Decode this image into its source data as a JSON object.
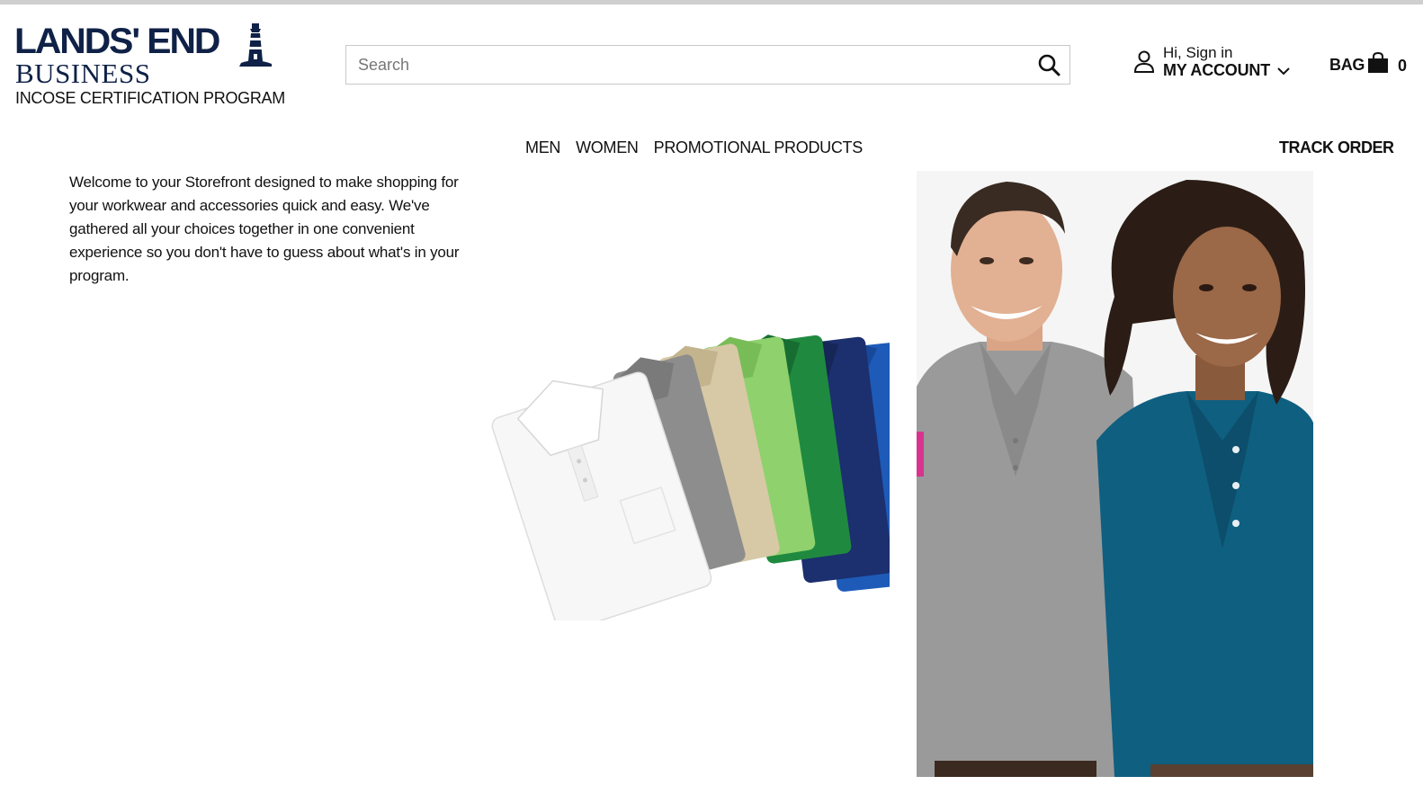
{
  "brand": {
    "logo_main": "LANDS' END",
    "logo_sub": "BUSINESS",
    "program": "INCOSE CERTIFICATION PROGRAM"
  },
  "search": {
    "placeholder": "Search",
    "value": ""
  },
  "account": {
    "greeting": "Hi, Sign in",
    "label": "MY ACCOUNT"
  },
  "bag": {
    "label": "BAG",
    "count": "0"
  },
  "nav": {
    "items": [
      {
        "label": "MEN"
      },
      {
        "label": "WOMEN"
      },
      {
        "label": "PROMOTIONAL PRODUCTS"
      }
    ],
    "track_order": "TRACK ORDER"
  },
  "welcome": {
    "text": "Welcome to your Storefront designed to make shopping for your workwear and accessories quick and easy. We've gathered all your choices together in one convenient experience so you don't have to guess about what's in your program."
  },
  "icons": {
    "search": "search-icon",
    "account": "user-icon",
    "chevron": "chevron-down-icon",
    "bag": "shopping-bag-icon",
    "lighthouse": "lighthouse-icon"
  },
  "colors": {
    "brand_navy": "#0f2147",
    "polo_white": "#f7f7f7",
    "polo_gray": "#8d8d8d",
    "polo_khaki": "#d7c9a6",
    "polo_lightgreen": "#8fd16d",
    "polo_green": "#1f8a3f",
    "polo_navy": "#1c2f6e",
    "polo_blue": "#1e5bb8",
    "man_shirt": "#9a9a9a",
    "woman_shirt": "#0f5f80"
  }
}
